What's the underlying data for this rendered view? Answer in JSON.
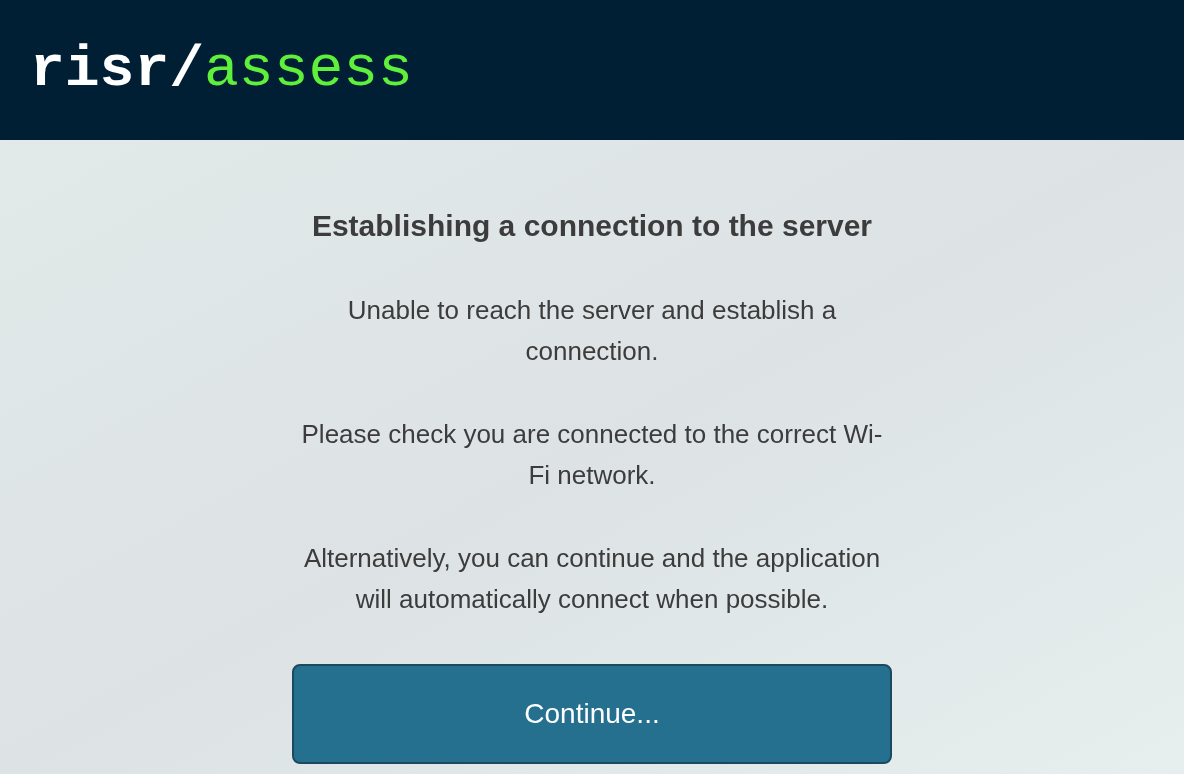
{
  "header": {
    "logo": {
      "primary": "risr/",
      "accent": "assess"
    }
  },
  "dialog": {
    "title": "Establishing a connection to the server",
    "paragraphs": [
      "Unable to reach the server and establish a connection.",
      "Please check you are connected to the correct Wi-Fi network.",
      "Alternatively, you can continue and the application will automatically connect when possible."
    ],
    "button": {
      "label": "Continue..."
    }
  }
}
